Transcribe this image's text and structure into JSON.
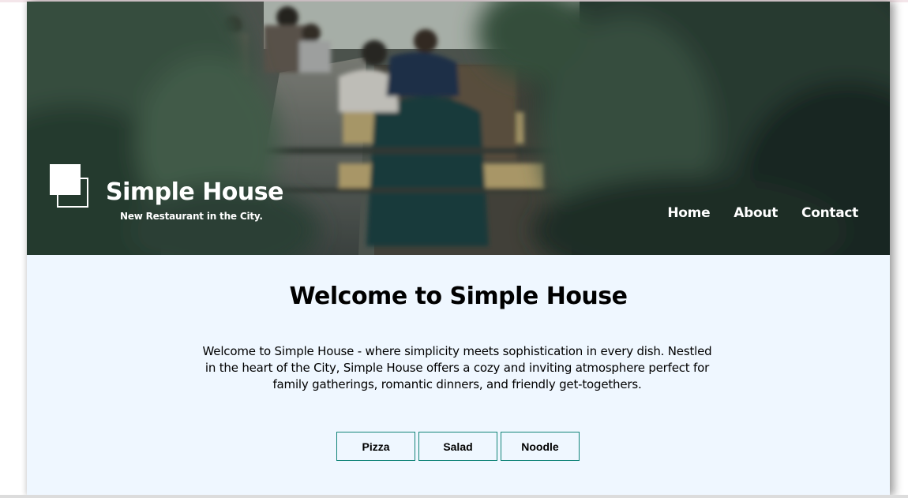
{
  "header": {
    "brand_title": "Simple House",
    "brand_tagline": "New Restaurant in the City.",
    "nav": [
      {
        "label": "Home"
      },
      {
        "label": "About"
      },
      {
        "label": "Contact"
      }
    ]
  },
  "main": {
    "title": "Welcome to Simple House",
    "intro": "Welcome to Simple House - where simplicity meets sophistication in every dish. Nestled in the heart of the City, Simple House offers a cozy and inviting atmosphere perfect for family gatherings, romantic dinners, and friendly get-togethers.",
    "tabs": [
      {
        "label": "Pizza"
      },
      {
        "label": "Salad"
      },
      {
        "label": "Noodle"
      }
    ]
  },
  "colors": {
    "page_background": "#eff7ff",
    "tab_border": "#14857a",
    "hero_text": "#ffffff"
  }
}
